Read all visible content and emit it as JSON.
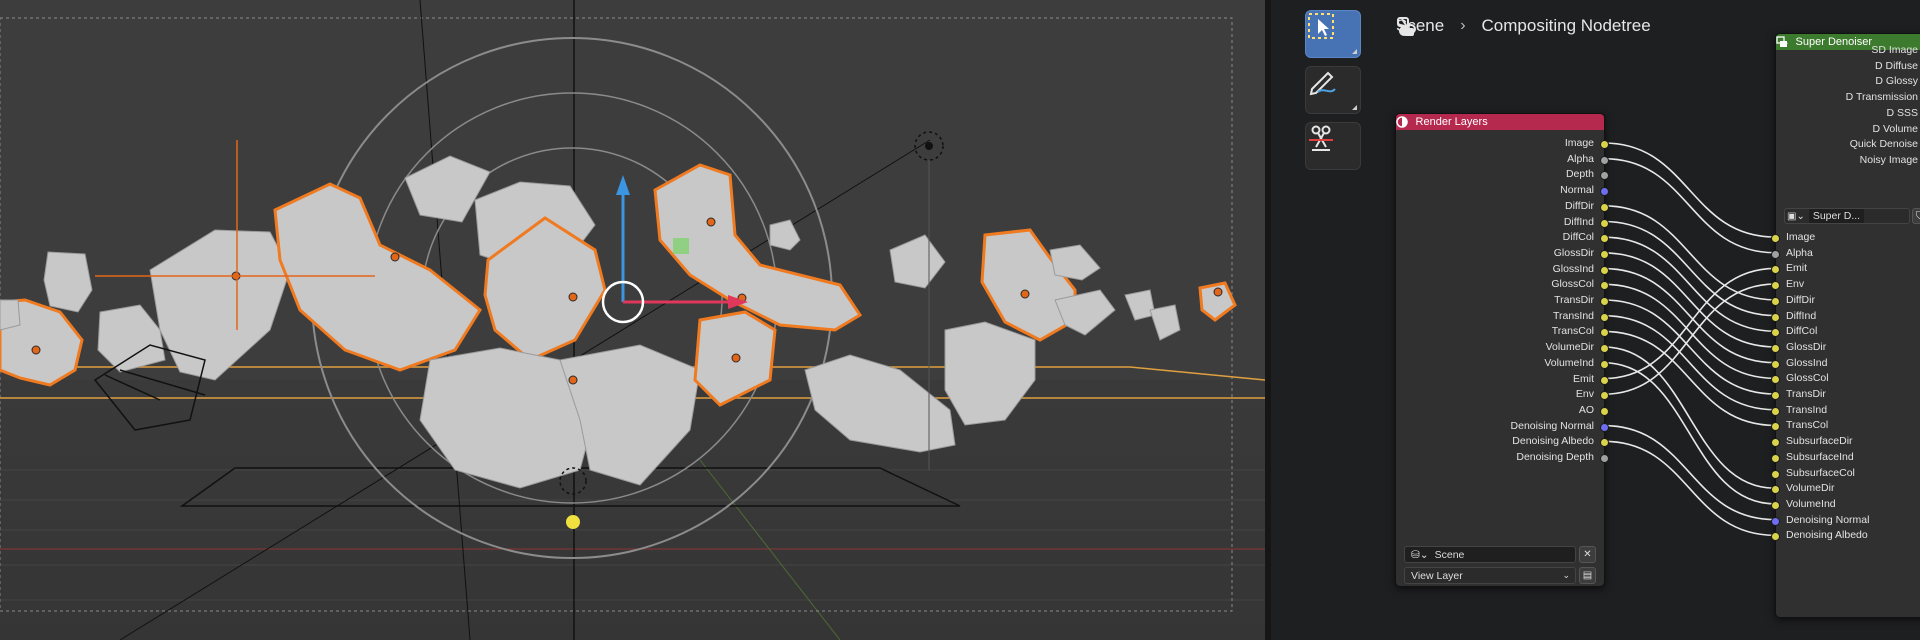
{
  "colors": {
    "viewport_bg": "#3d3d3d",
    "selection_orange": "#f07a20",
    "render_layers_header": "#b5294f",
    "super_denoiser_header": "#3c7a2e",
    "socket_color": "#d8d34a",
    "socket_gray": "#a0a0a0",
    "socket_vector": "#6d6df0",
    "active_tool": "#4772b3"
  },
  "toolbar": {
    "tools": [
      {
        "icon": "select-box-icon",
        "active": true
      },
      {
        "icon": "annotate-icon",
        "active": false
      },
      {
        "icon": "cut-links-icon",
        "active": false
      }
    ]
  },
  "breadcrumb": {
    "scene": "Scene",
    "separator": "›",
    "nodetree": "Compositing Nodetree"
  },
  "render_layers": {
    "title": "Render Layers",
    "outputs": [
      {
        "label": "Image",
        "type": "color"
      },
      {
        "label": "Alpha",
        "type": "gray"
      },
      {
        "label": "Depth",
        "type": "gray"
      },
      {
        "label": "Normal",
        "type": "vector"
      },
      {
        "label": "DiffDir",
        "type": "color"
      },
      {
        "label": "DiffInd",
        "type": "color"
      },
      {
        "label": "DiffCol",
        "type": "color"
      },
      {
        "label": "GlossDir",
        "type": "color"
      },
      {
        "label": "GlossInd",
        "type": "color"
      },
      {
        "label": "GlossCol",
        "type": "color"
      },
      {
        "label": "TransDir",
        "type": "color"
      },
      {
        "label": "TransInd",
        "type": "color"
      },
      {
        "label": "TransCol",
        "type": "color"
      },
      {
        "label": "VolumeDir",
        "type": "color"
      },
      {
        "label": "VolumeInd",
        "type": "color"
      },
      {
        "label": "Emit",
        "type": "color"
      },
      {
        "label": "Env",
        "type": "color"
      },
      {
        "label": "AO",
        "type": "color"
      },
      {
        "label": "Denoising Normal",
        "type": "vector"
      },
      {
        "label": "Denoising Albedo",
        "type": "color"
      },
      {
        "label": "Denoising Depth",
        "type": "gray"
      }
    ],
    "scene_field": "Scene",
    "view_layer_field": "View Layer"
  },
  "super_denoiser": {
    "title": "Super Denoiser",
    "outputs": [
      {
        "label": "SD Image",
        "type": "color"
      },
      {
        "label": "D Diffuse",
        "type": "color"
      },
      {
        "label": "D Glossy",
        "type": "color"
      },
      {
        "label": "D Transmission",
        "type": "color"
      },
      {
        "label": "D SSS",
        "type": "color"
      },
      {
        "label": "D Volume",
        "type": "color"
      },
      {
        "label": "Quick Denoise",
        "type": "color"
      },
      {
        "label": "Noisy Image",
        "type": "color"
      }
    ],
    "group_field": "Super D...",
    "inputs": [
      {
        "label": "Image",
        "type": "color"
      },
      {
        "label": "Alpha",
        "type": "gray"
      },
      {
        "label": "Emit",
        "type": "color"
      },
      {
        "label": "Env",
        "type": "color"
      },
      {
        "label": "DiffDir",
        "type": "color"
      },
      {
        "label": "DiffInd",
        "type": "color"
      },
      {
        "label": "DiffCol",
        "type": "color"
      },
      {
        "label": "GlossDir",
        "type": "color"
      },
      {
        "label": "GlossInd",
        "type": "color"
      },
      {
        "label": "GlossCol",
        "type": "color"
      },
      {
        "label": "TransDir",
        "type": "color"
      },
      {
        "label": "TransInd",
        "type": "color"
      },
      {
        "label": "TransCol",
        "type": "color"
      },
      {
        "label": "SubsurfaceDir",
        "type": "color"
      },
      {
        "label": "SubsurfaceInd",
        "type": "color"
      },
      {
        "label": "SubsurfaceCol",
        "type": "color"
      },
      {
        "label": "VolumeDir",
        "type": "color"
      },
      {
        "label": "VolumeInd",
        "type": "color"
      },
      {
        "label": "Denoising Normal",
        "type": "vector"
      },
      {
        "label": "Denoising Albedo",
        "type": "color"
      }
    ]
  },
  "links": [
    [
      "Image",
      "Image"
    ],
    [
      "Alpha",
      "Alpha"
    ],
    [
      "Emit",
      "Emit"
    ],
    [
      "Env",
      "Env"
    ],
    [
      "DiffDir",
      "DiffDir"
    ],
    [
      "DiffInd",
      "DiffInd"
    ],
    [
      "DiffCol",
      "DiffCol"
    ],
    [
      "GlossDir",
      "GlossDir"
    ],
    [
      "GlossInd",
      "GlossInd"
    ],
    [
      "GlossCol",
      "GlossCol"
    ],
    [
      "TransDir",
      "TransDir"
    ],
    [
      "TransInd",
      "TransInd"
    ],
    [
      "TransCol",
      "TransCol"
    ],
    [
      "VolumeDir",
      "VolumeDir"
    ],
    [
      "VolumeInd",
      "VolumeInd"
    ],
    [
      "Denoising Normal",
      "Denoising Normal"
    ],
    [
      "Denoising Albedo",
      "Denoising Albedo"
    ]
  ]
}
